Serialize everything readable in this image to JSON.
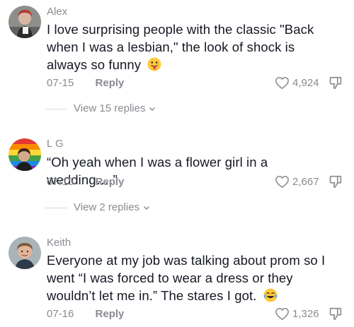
{
  "comments": [
    {
      "author": "Alex",
      "text": "I love surprising people with the classic \"Back when I was a lesbian,\" the look of shock is always so funny",
      "emoji": "tongue-out-emoji",
      "date": "07-15",
      "reply_label": "Reply",
      "likes": "4,924",
      "view_replies": "View 15 replies"
    },
    {
      "author": "L G",
      "text": "“Oh yeah when I was a flower girl in a wedding….”",
      "date": "07-15",
      "reply_label": "Reply",
      "likes": "2,667",
      "view_replies": "View 2 replies"
    },
    {
      "author": "Keith",
      "text": "Everyone at my job was talking about prom so I went “I was forced to wear a dress or they wouldn’t let me in.” The stares I got.",
      "emoji": "tears-of-joy-emoji",
      "date": "07-16",
      "reply_label": "Reply",
      "likes": "1,326"
    }
  ]
}
